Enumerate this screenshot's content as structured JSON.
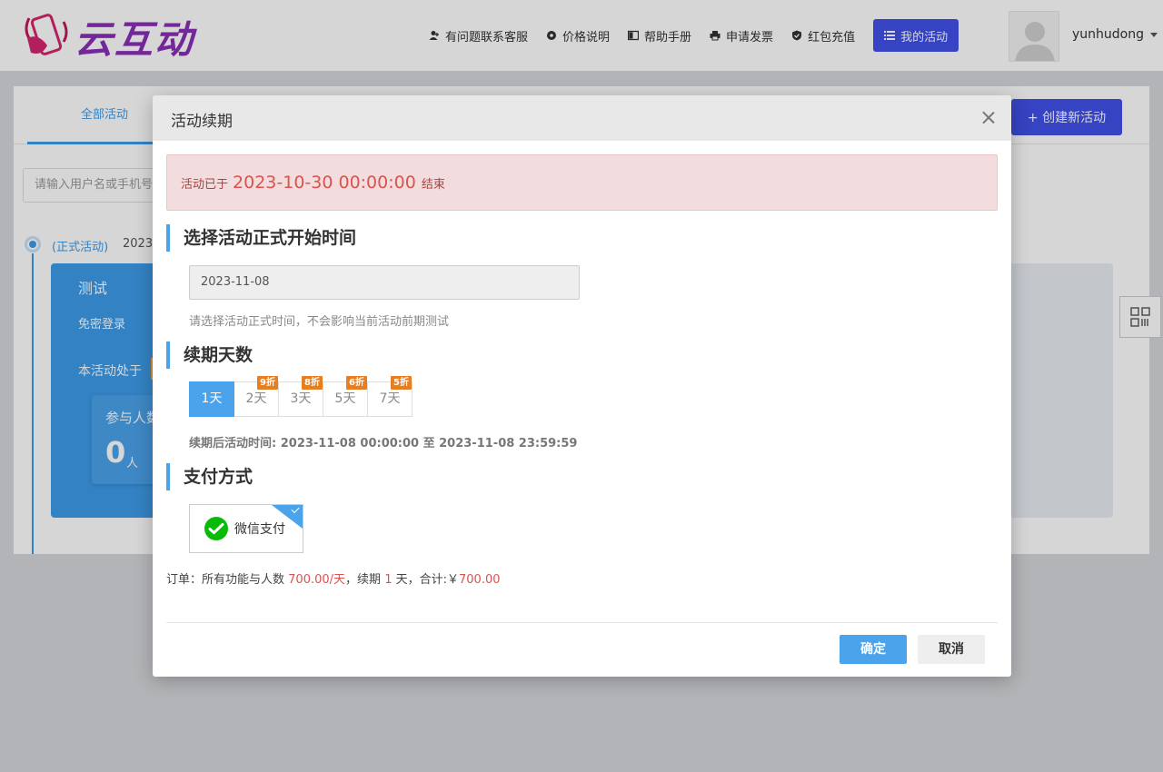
{
  "brand": {
    "name": "云互动"
  },
  "nav": {
    "items": [
      {
        "label": "有问题联系客服",
        "icon": "user-plus-icon"
      },
      {
        "label": "价格说明",
        "icon": "gear-icon"
      },
      {
        "label": "帮助手册",
        "icon": "book-icon"
      },
      {
        "label": "申请发票",
        "icon": "printer-icon"
      },
      {
        "label": "红包充值",
        "icon": "shield-check-icon"
      }
    ],
    "my_activity": "我的活动",
    "username": "yunhudong"
  },
  "page": {
    "tab_all": "全部活动",
    "create_button": "+ 创建新活动",
    "search_placeholder": "请输入用户名或手机号",
    "timeline_status": "(正式活动)",
    "timeline_date": "2023-",
    "card": {
      "name": "测试",
      "free_login": "免密登录",
      "state_prefix": "本活动处于",
      "participants_label": "参与人数",
      "participants_value": "0",
      "participants_unit": "人"
    }
  },
  "modal": {
    "title": "活动续期",
    "alert": {
      "prefix": "活动已于",
      "datetime": "2023-10-30 00:00:00",
      "suffix": "结束"
    },
    "section_start": "选择活动正式开始时间",
    "start_date": "2023-11-08",
    "start_hint": "请选择活动正式时间，不会影响当前活动前期测试",
    "section_days": "续期天数",
    "day_options": [
      {
        "label": "1天",
        "discount": "",
        "active": true
      },
      {
        "label": "2天",
        "discount": "9折",
        "active": false
      },
      {
        "label": "3天",
        "discount": "8折",
        "active": false
      },
      {
        "label": "5天",
        "discount": "6折",
        "active": false
      },
      {
        "label": "7天",
        "discount": "5折",
        "active": false
      }
    ],
    "after_renew": "续期后活动时间: 2023-11-08 00:00:00 至 2023-11-08 23:59:59",
    "section_pay": "支付方式",
    "pay_method": "微信支付",
    "order": {
      "prefix": "订单：所有功能与人数",
      "price": "700.00/天",
      "mid": "，续期",
      "days": "1",
      "unit_total": "天，合计:￥",
      "total": "700.00"
    },
    "ok": "确定",
    "cancel": "取消"
  },
  "colors": {
    "primary": "#4150e8",
    "accent": "#4aa3eb",
    "danger": "#d9534f",
    "discount": "#e67e22",
    "wechat": "#09bb07"
  }
}
